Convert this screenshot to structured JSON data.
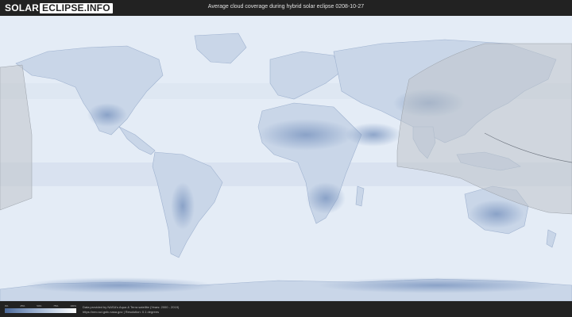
{
  "header": {
    "logo_word": "SOLAR",
    "logo_box": "ECLIPSE.INFO",
    "title": "Average cloud coverage during hybrid solar eclipse 0208-10-27"
  },
  "map": {
    "land_color": "#7f99c2",
    "ocean_color": "#e4ecf6",
    "overlay_color": "#bfc4cb"
  },
  "legend": {
    "ticks": [
      "0%",
      "25%",
      "50%",
      "75%",
      "100%"
    ]
  },
  "footer": {
    "credit_line_1": "Data provided by NASA's Aqua & Terra satellite (Years: 2000 - 2019)",
    "credit_line_2": "https://neo.sci.gsfc.nasa.gov | Resolution: 0.1 degrees"
  }
}
